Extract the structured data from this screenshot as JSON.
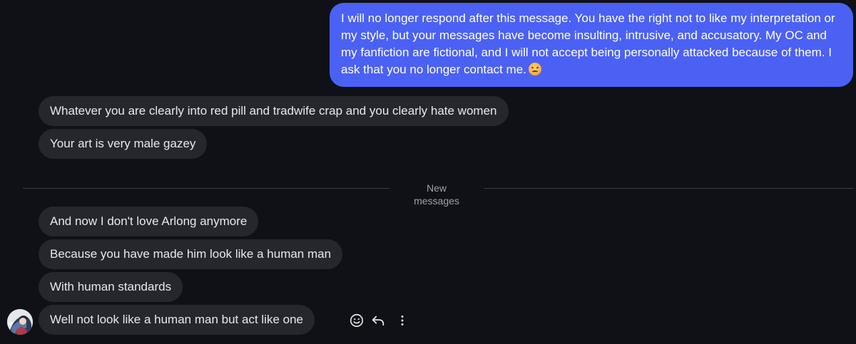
{
  "messages": {
    "outgoing": [
      {
        "text": "I will no longer respond after this message. You have the right not to like my interpretation or my style, but your messages have become insulting, intrusive, and accusatory. My OC and my fanfiction are fictional, and I will not accept being personally attacked because of them. I ask that you no longer contact me.",
        "emoji": "slightly-frowning-face"
      }
    ],
    "incoming_before": [
      {
        "text": "Whatever you are clearly into red pill and tradwife crap and you clearly hate women"
      },
      {
        "text": "Your art is very male gazey"
      }
    ],
    "divider_label": "New messages",
    "incoming_after": [
      {
        "text": "And now I don't love Arlong anymore"
      },
      {
        "text": "Because you have made him look like a human man"
      },
      {
        "text": "With human standards"
      },
      {
        "text": "Well not look like a human man but act like one"
      }
    ]
  },
  "message_actions": [
    "smiley-icon",
    "reply-icon",
    "more-vertical-icon"
  ],
  "colors": {
    "background": "#0f1116",
    "outgoing_bubble": "#4b61f4",
    "incoming_bubble": "#25272d",
    "divider": "#3a3d44"
  }
}
